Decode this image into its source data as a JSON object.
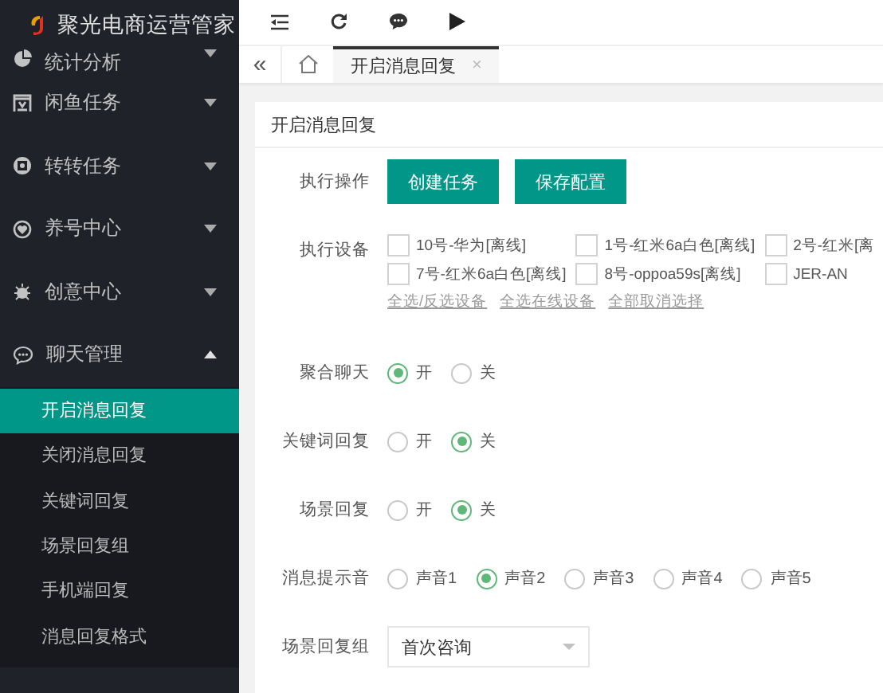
{
  "sidebar": {
    "logo": "聚光电商运营管家",
    "menu": [
      {
        "label": "统计分析",
        "expanded": false
      },
      {
        "label": "闲鱼任务",
        "expanded": false
      },
      {
        "label": "转转任务",
        "expanded": false
      },
      {
        "label": "养号中心",
        "expanded": false
      },
      {
        "label": "创意中心",
        "expanded": false
      },
      {
        "label": "聊天管理",
        "expanded": true,
        "children": [
          {
            "label": "开启消息回复",
            "selected": true
          },
          {
            "label": "关闭消息回复",
            "selected": false
          },
          {
            "label": "关键词回复",
            "selected": false
          },
          {
            "label": "场景回复组",
            "selected": false
          },
          {
            "label": "手机端回复",
            "selected": false
          },
          {
            "label": "消息回复格式",
            "selected": false
          }
        ]
      }
    ]
  },
  "tabs": {
    "collapse": "«",
    "items": [
      {
        "label": "开启消息回复",
        "selected": true,
        "close": "×"
      }
    ]
  },
  "card": {
    "title": "开启消息回复",
    "rows": [
      {
        "kind": "buttons",
        "label": "执行操作",
        "buttons": [
          "创建任务",
          "保存配置"
        ]
      },
      {
        "kind": "checkboxes",
        "label": "执行设备",
        "options": [
          {
            "label": "10号-华为[离线]",
            "checked": false
          },
          {
            "label": "1号-红米6a白色[离线]",
            "checked": false
          },
          {
            "label": "2号-红米[离",
            "checked": false
          },
          {
            "label": "7号-红米6a白色[离线]",
            "checked": false
          },
          {
            "label": "8号-oppoa59s[离线]",
            "checked": false
          },
          {
            "label": "JER-AN",
            "checked": false
          }
        ],
        "links": [
          "全选/反选设备",
          "全选在线设备",
          "全部取消选择"
        ]
      },
      {
        "kind": "radio",
        "label": "聚合聊天",
        "options": [
          {
            "label": "开",
            "selected": true
          },
          {
            "label": "关",
            "selected": false
          }
        ]
      },
      {
        "kind": "radio",
        "label": "关键词回复",
        "options": [
          {
            "label": "开",
            "selected": false
          },
          {
            "label": "关",
            "selected": true
          }
        ]
      },
      {
        "kind": "radio",
        "label": "场景回复",
        "options": [
          {
            "label": "开",
            "selected": false
          },
          {
            "label": "关",
            "selected": true
          }
        ]
      },
      {
        "kind": "radio",
        "label": "消息提示音",
        "options": [
          {
            "label": "声音1",
            "selected": false
          },
          {
            "label": "声音2",
            "selected": true
          },
          {
            "label": "声音3",
            "selected": false
          },
          {
            "label": "声音4",
            "selected": false
          },
          {
            "label": "声音5",
            "selected": false
          }
        ]
      },
      {
        "kind": "select",
        "label": "场景回复组",
        "value": "首次咨询"
      }
    ]
  }
}
